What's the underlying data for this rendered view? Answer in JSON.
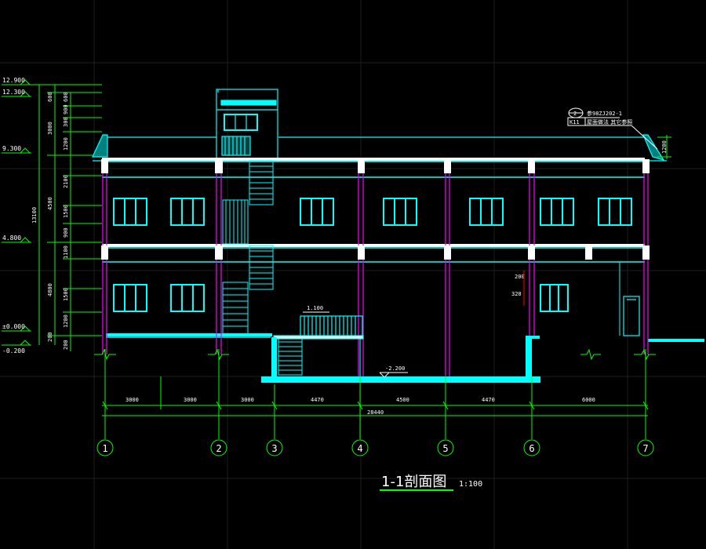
{
  "title": {
    "text": "1-1剖面图",
    "scale": "1:100"
  },
  "elevations": [
    {
      "label": "12.900"
    },
    {
      "label": "12.300"
    },
    {
      "label": "9.300"
    },
    {
      "label": "4.800"
    },
    {
      "label": "±0.000"
    },
    {
      "label": "-0.200"
    }
  ],
  "vertical_dims": {
    "total": "13100",
    "segments_outer": [
      "600",
      "3000",
      "4500",
      "4800",
      "200"
    ],
    "segments_inner": [
      "600",
      "900",
      "300",
      "1200",
      "2100",
      "1500",
      "900",
      "1100",
      "1500",
      "1200",
      "200"
    ]
  },
  "horizontal_dims": {
    "segments": [
      "3000",
      "3000",
      "3000",
      "4470",
      "4500",
      "4470",
      "6000"
    ],
    "total": "28440"
  },
  "axes": [
    "1",
    "2",
    "3",
    "4",
    "5",
    "6",
    "7"
  ],
  "annotations": {
    "ref_number": "2",
    "ref_code": "参98ZJ202-1",
    "k_code": "K11",
    "ref_note": "屋面做法 其它参照",
    "parapet_dim": "1200",
    "stair_level": "1.100",
    "basement_level": "-2.200",
    "window_dim_a": "200",
    "window_dim_b": "320"
  },
  "colors": {
    "structure": "#00ffff",
    "dimension": "#00ff00",
    "column": "#ff00ff",
    "text": "#ffffff",
    "grid": "#202020"
  }
}
